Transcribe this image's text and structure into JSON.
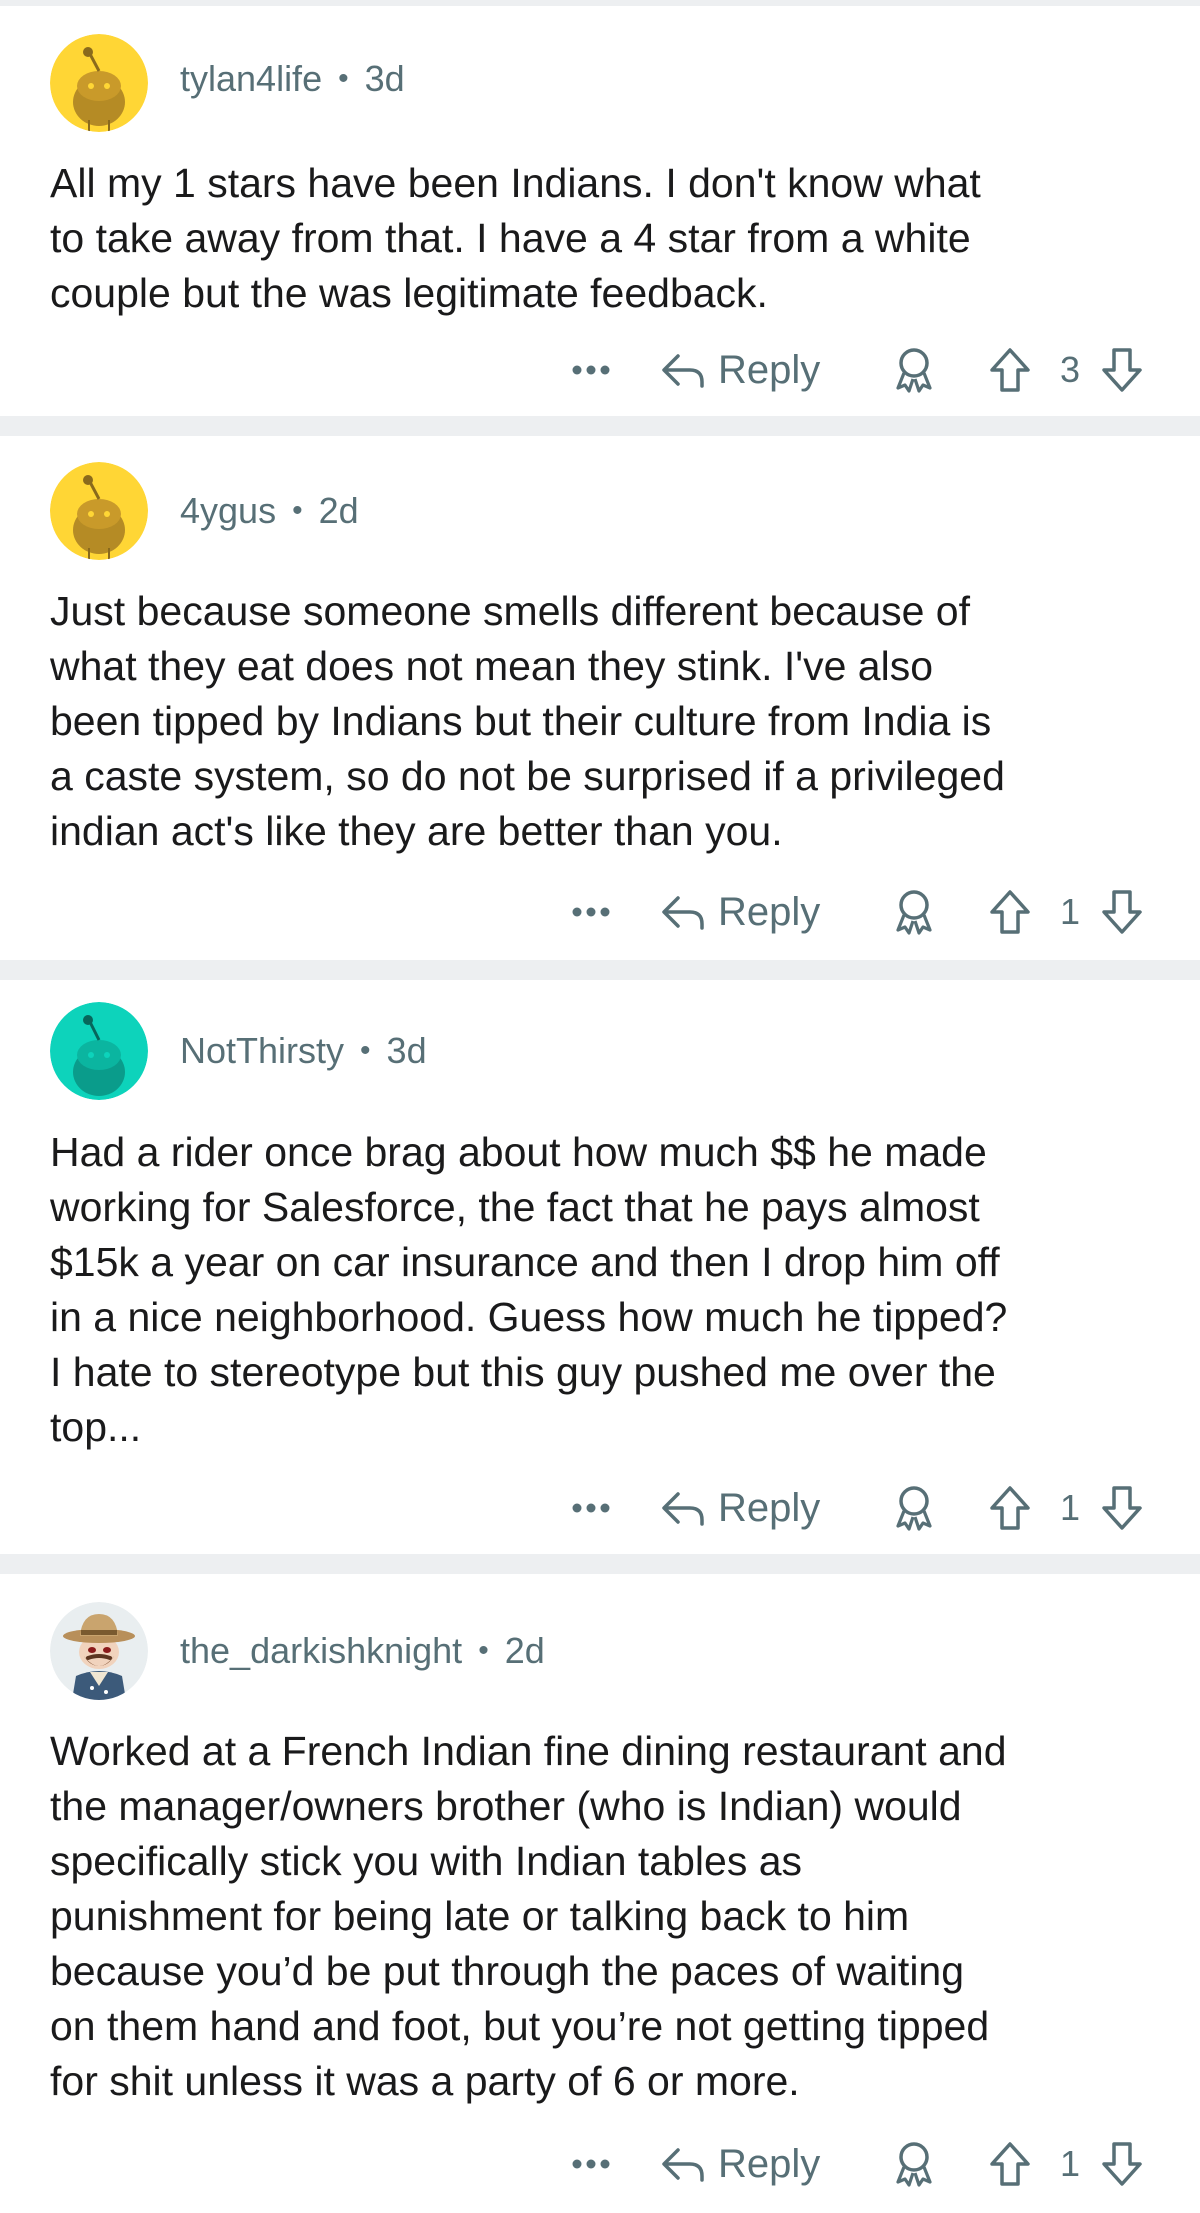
{
  "comments": [
    {
      "username": "tylan4life",
      "separator": "•",
      "age": "3d",
      "avatar_icon": "reddit-snoo-yellow-avatar-icon",
      "avatar_color": "#ffd635",
      "text": "All my 1 stars have been Indians. I don't know what\nto take away from that. I have a 4 star from a white\ncouple but the was legitimate feedback.",
      "reply_label": "Reply",
      "score": "3"
    },
    {
      "username": "4ygus",
      "separator": "•",
      "age": "2d",
      "avatar_icon": "reddit-snoo-yellow-avatar-icon",
      "avatar_color": "#ffd635",
      "text": "Just because someone smells different because of\nwhat they eat does not mean they stink. I've also\nbeen tipped by Indians but their culture from India is\na caste system, so do not be surprised if a privileged\nindian act's like they are better than you.",
      "reply_label": "Reply",
      "score": "1"
    },
    {
      "username": "NotThirsty",
      "separator": "•",
      "age": "3d",
      "avatar_icon": "reddit-snoo-teal-avatar-icon",
      "avatar_color": "#0dd3bb",
      "text": "Had a rider once brag about how much $$ he made\nworking for Salesforce, the fact that he pays almost\n$15k a year on car insurance and then I drop him off\nin a nice neighborhood. Guess how much he tipped?\nI hate to stereotype but this guy pushed me over the\ntop...",
      "reply_label": "Reply",
      "score": "1"
    },
    {
      "username": "the_darkishknight",
      "separator": "•",
      "age": "2d",
      "avatar_icon": "cowboy-snoo-avatar-icon",
      "avatar_color": "#e9eef0",
      "text": "Worked at a French Indian fine dining restaurant and\nthe manager/owners brother (who is Indian) would\nspecifically stick you with Indian tables as\npunishment for being late or talking back to him\nbecause you’d be put through the paces of waiting\non them hand and foot, but you’re not getting tipped\nfor shit unless it was a party of 6 or more.",
      "reply_label": "Reply",
      "score": "1"
    }
  ],
  "icons": {
    "more": "more-options-icon",
    "reply": "reply-arrow-icon",
    "award": "award-icon",
    "upvote": "upvote-arrow-icon",
    "downvote": "downvote-arrow-icon"
  },
  "colors": {
    "meta_text": "#576f76",
    "body_text": "#1a1a1b",
    "divider": "#edeff1"
  }
}
